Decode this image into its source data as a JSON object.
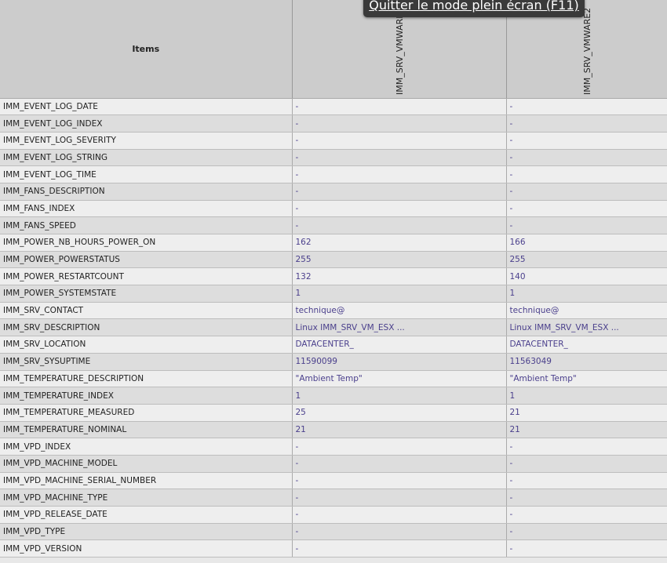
{
  "header": {
    "items": "Items",
    "columns": [
      "IMM_SRV_VMWARE",
      "IMM_SRV_VMWARE2"
    ]
  },
  "rows": [
    {
      "name": "IMM_EVENT_LOG_DATE",
      "v": [
        "-",
        "-"
      ]
    },
    {
      "name": "IMM_EVENT_LOG_INDEX",
      "v": [
        "-",
        "-"
      ]
    },
    {
      "name": "IMM_EVENT_LOG_SEVERITY",
      "v": [
        "-",
        "-"
      ]
    },
    {
      "name": "IMM_EVENT_LOG_STRING",
      "v": [
        "-",
        "-"
      ]
    },
    {
      "name": "IMM_EVENT_LOG_TIME",
      "v": [
        "-",
        "-"
      ]
    },
    {
      "name": "IMM_FANS_DESCRIPTION",
      "v": [
        "-",
        "-"
      ]
    },
    {
      "name": "IMM_FANS_INDEX",
      "v": [
        "-",
        "-"
      ]
    },
    {
      "name": "IMM_FANS_SPEED",
      "v": [
        "-",
        "-"
      ]
    },
    {
      "name": "IMM_POWER_NB_HOURS_POWER_ON",
      "v": [
        "162",
        "166"
      ]
    },
    {
      "name": "IMM_POWER_POWERSTATUS",
      "v": [
        "255",
        "255"
      ]
    },
    {
      "name": "IMM_POWER_RESTARTCOUNT",
      "v": [
        "132",
        "140"
      ]
    },
    {
      "name": "IMM_POWER_SYSTEMSTATE",
      "v": [
        "1",
        "1"
      ]
    },
    {
      "name": "IMM_SRV_CONTACT",
      "v": [
        "technique@",
        "technique@"
      ]
    },
    {
      "name": "IMM_SRV_DESCRIPTION",
      "v": [
        "Linux IMM_SRV_VM_ESX ...",
        "Linux IMM_SRV_VM_ESX ..."
      ]
    },
    {
      "name": "IMM_SRV_LOCATION",
      "v": [
        "DATACENTER_",
        "DATACENTER_"
      ]
    },
    {
      "name": "IMM_SRV_SYSUPTIME",
      "v": [
        "11590099",
        "11563049"
      ]
    },
    {
      "name": "IMM_TEMPERATURE_DESCRIPTION",
      "v": [
        "\"Ambient Temp\"",
        "\"Ambient Temp\""
      ]
    },
    {
      "name": "IMM_TEMPERATURE_INDEX",
      "v": [
        "1",
        "1"
      ]
    },
    {
      "name": "IMM_TEMPERATURE_MEASURED",
      "v": [
        "25",
        "21"
      ]
    },
    {
      "name": "IMM_TEMPERATURE_NOMINAL",
      "v": [
        "21",
        "21"
      ]
    },
    {
      "name": "IMM_VPD_INDEX",
      "v": [
        "-",
        "-"
      ]
    },
    {
      "name": "IMM_VPD_MACHINE_MODEL",
      "v": [
        "-",
        "-"
      ]
    },
    {
      "name": "IMM_VPD_MACHINE_SERIAL_NUMBER",
      "v": [
        "-",
        "-"
      ]
    },
    {
      "name": "IMM_VPD_MACHINE_TYPE",
      "v": [
        "-",
        "-"
      ]
    },
    {
      "name": "IMM_VPD_RELEASE_DATE",
      "v": [
        "-",
        "-"
      ]
    },
    {
      "name": "IMM_VPD_TYPE",
      "v": [
        "-",
        "-"
      ]
    },
    {
      "name": "IMM_VPD_VERSION",
      "v": [
        "-",
        "-"
      ]
    }
  ],
  "fullscreen_tip": "Quitter le mode plein écran (F11)"
}
